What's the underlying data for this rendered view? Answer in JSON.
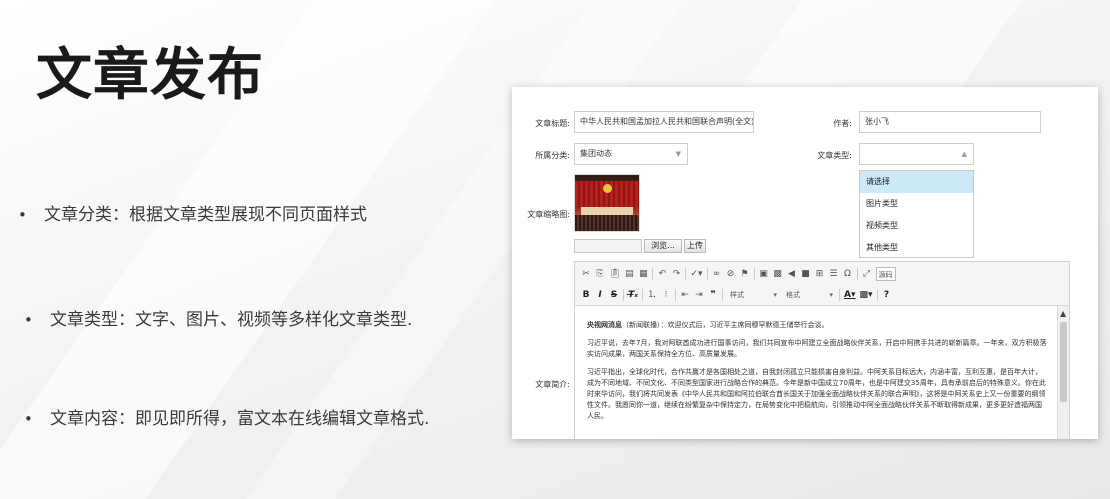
{
  "slide": {
    "title": "文章发布",
    "bullets": [
      "文章分类：根据文章类型展现不同页面样式",
      "文章类型：文字、图片、视频等多样化文章类型.",
      "文章内容：即见即所得，富文本在线编辑文章格式."
    ],
    "bullet_symbol": "•"
  },
  "form": {
    "title_label": "文章标题:",
    "title_value": "中华人民共和国孟加拉人民共和国联合声明(全文)",
    "author_label": "作者:",
    "author_value": "张小飞",
    "category_label": "所属分类:",
    "category_value": "集团动态",
    "type_label": "文章类型:",
    "type_value": "",
    "type_options": [
      "请选择",
      "图片类型",
      "视频类型",
      "其他类型"
    ],
    "thumb_label": "文章缩略图:",
    "browse_label": "浏览...",
    "upload_label": "上传",
    "summary_label": "文章简介:"
  },
  "editor": {
    "style_combo": "样式",
    "format_combo": "格式",
    "source_label": "源码",
    "paragraphs": [
      "央视网消息（新闻联播）：欢迎仪式后，习近平主席同穆罕默德王储举行会谈。",
      "习近平说，去年7月，我对阿联酋成功进行国事访问，我们共同宣布中阿建立全面战略伙伴关系，开启中阿携手共进的崭新篇章。一年来，双方积极落实访问成果，两国关系保持全方位、高质量发展。",
      "习近平指出，全球化时代，合作共赢才是各国相处之道，自我封闭孤立只能损害自身利益。中阿关系目标远大，内涵丰富，互利互惠，是百年大计，成为不同地域、不同文化、不同类型国家进行战略合作的典范。今年是新中国成立70周年，也是中阿建交35周年，具有承前启后的特殊意义。你在此时来华访问，我们将共同发表《中华人民共和国和阿拉伯联合酋长国关于加强全面战略伙伴关系的联合声明》，这将是中阿关系史上又一份重要的纲领性文件。我愿同你一道，继续在纷繁复杂中保持定力，在局势变化中把稳航向，引领推动中阿全面战略伙伴关系不断取得新成果，更多更好造福两国人民。"
    ],
    "lead_bold": "央视网消息"
  },
  "colors": {
    "dropdown_highlight": "#cde8f6",
    "title_color": "#1a1a1a"
  }
}
